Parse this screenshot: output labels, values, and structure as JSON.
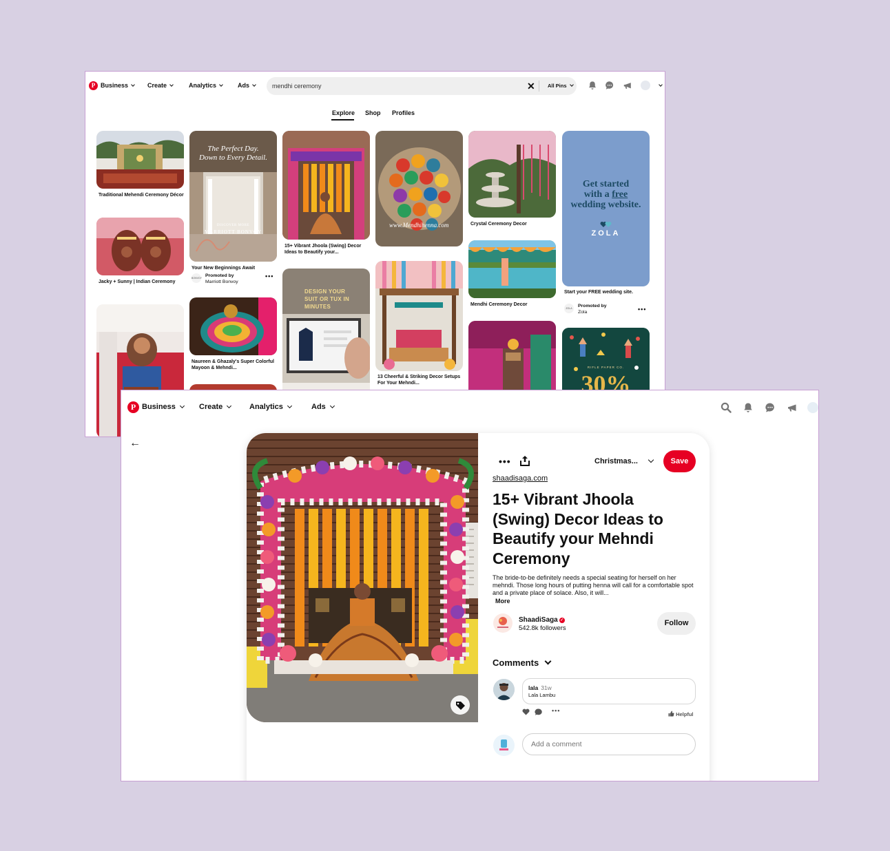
{
  "back_window": {
    "nav": {
      "menus": [
        "Business",
        "Create",
        "Analytics",
        "Ads"
      ],
      "search_value": "mendhi ceremony",
      "search_filter": "All Pins"
    },
    "tabs": [
      "Explore",
      "Shop",
      "Profiles"
    ],
    "active_tab": "Explore",
    "pins": {
      "p1_caption": "Traditional Mehendi Ceremony Décor",
      "p2_caption": "Jacky + Sunny | Indian Ceremony",
      "p3_overlay_line1": "The Perfect Day.",
      "p3_overlay_line2": "Down to Every Detail.",
      "p3_overlay_discover": "DISCOVER MORE",
      "p3_overlay_brand": "MARRIOTT BONVOY",
      "p3_caption": "Your New Beginnings Await",
      "p3_promoted": "Promoted by",
      "p3_advertiser": "Marriott Bonvoy",
      "p4_caption": "Naureen & Ghazaly's Super Colorful Mayoon & Mehndi...",
      "p5_caption": "15+ Vibrant Jhoola (Swing) Decor Ideas to Beautify your...",
      "p6_overlay": "DESIGN YOUR SUIT OR TUX IN MINUTES",
      "p7_watermark": "www.Mendhihenna.com",
      "p8_caption": "13 Cheerful & Striking Decor Setups For Your Mehndi...",
      "p9_caption": "Crystal Ceremony Decor",
      "p10_caption": "Mendhi Ceremony Decor",
      "zola_line1": "Get started",
      "zola_line2a": "with a ",
      "zola_line2b": "free",
      "zola_line3": "wedding website.",
      "zola_brand": "ZOLA",
      "zola_caption": "Start your FREE wedding site.",
      "zola_promoted": "Promoted by",
      "zola_advertiser": "Zola",
      "rifle_brand": "RIFLE PAPER CO.",
      "rifle_big": "30%"
    }
  },
  "front_window": {
    "nav": {
      "menus": [
        "Business",
        "Create",
        "Analytics",
        "Ads"
      ]
    },
    "pin": {
      "board": "Christmas...",
      "save_label": "Save",
      "source": "shaadisaga.com",
      "title": "15+ Vibrant Jhoola (Swing) Decor Ideas to Beautify your Mehndi Ceremony",
      "description": "The bride-to-be definitely needs a special seating for herself on her mehndi. Those long hours of putting henna will call for a comfortable spot and a private place of solace. Also, it will...",
      "more_label": "More",
      "creator_name": "ShaadiSaga",
      "creator_followers": "542.8k followers",
      "follow_label": "Follow",
      "comments_heading": "Comments",
      "comment": {
        "user": "lala",
        "time": "31w",
        "text": "Lala Lambu",
        "helpful_label": "Helpful"
      },
      "add_comment_placeholder": "Add a comment"
    }
  },
  "colors": {
    "brand_red": "#e60023",
    "zola_blue": "#7c9dcc",
    "zola_text": "#1c4a63",
    "page_bg": "#d8d0e3"
  }
}
